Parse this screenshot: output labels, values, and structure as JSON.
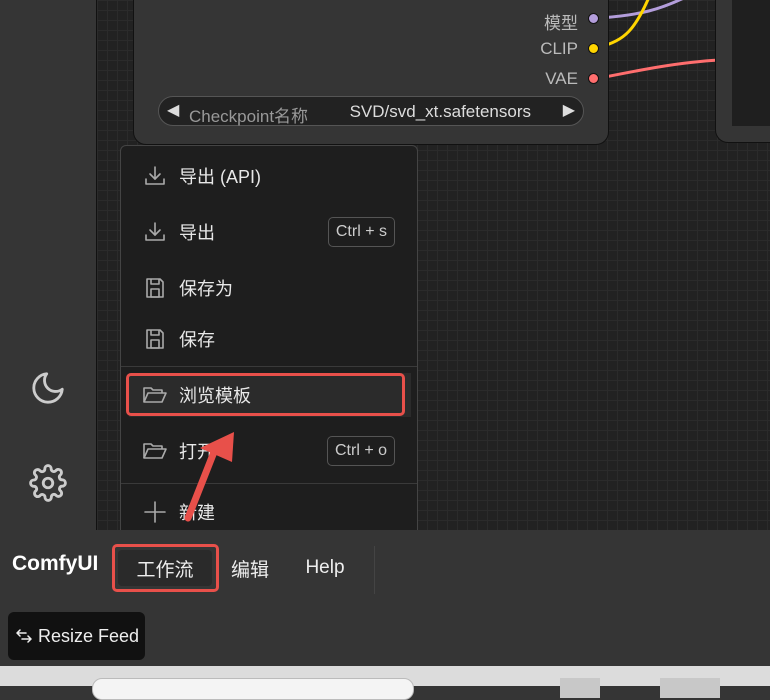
{
  "node": {
    "outputs": [
      {
        "label": "模型",
        "color": "#b39ddb"
      },
      {
        "label": "CLIP",
        "color": "#ffd500"
      },
      {
        "label": "VAE",
        "color": "#ff6e6e"
      }
    ],
    "widget": {
      "label": "Checkpoint名称",
      "value": "SVD/svd_xt.safetensors",
      "left_arrow": "◀",
      "right_arrow": "▶"
    }
  },
  "menu": {
    "items": [
      {
        "label": "导出 (API)",
        "icon": "download-icon",
        "shortcut": ""
      },
      {
        "label": "导出",
        "icon": "download-icon",
        "shortcut": "Ctrl + s"
      },
      {
        "label": "保存为",
        "icon": "save-icon",
        "shortcut": ""
      },
      {
        "label": "保存",
        "icon": "save-icon",
        "shortcut": ""
      },
      {
        "label": "浏览模板",
        "icon": "folder-open-icon",
        "shortcut": ""
      },
      {
        "label": "打开",
        "icon": "folder-open-icon",
        "shortcut": "Ctrl + o"
      },
      {
        "label": "新建",
        "icon": "plus-icon",
        "shortcut": ""
      }
    ],
    "highlighted_item": "浏览模板"
  },
  "menubar": {
    "brand": "ComfyUI",
    "items": [
      {
        "label": "工作流",
        "active": true
      },
      {
        "label": "编辑",
        "active": false
      },
      {
        "label": "Help",
        "active": false
      }
    ]
  },
  "sidebar": {
    "icons": [
      "moon-icon",
      "gear-icon"
    ]
  },
  "resize_feed": {
    "label": "Resize Feed",
    "icon": "resize-arrows-icon"
  },
  "colors": {
    "highlight": "#e8504a",
    "accent_wire_purple": "#b39ddb",
    "accent_wire_yellow": "#ffd500",
    "accent_wire_red": "#ff6e6e"
  }
}
